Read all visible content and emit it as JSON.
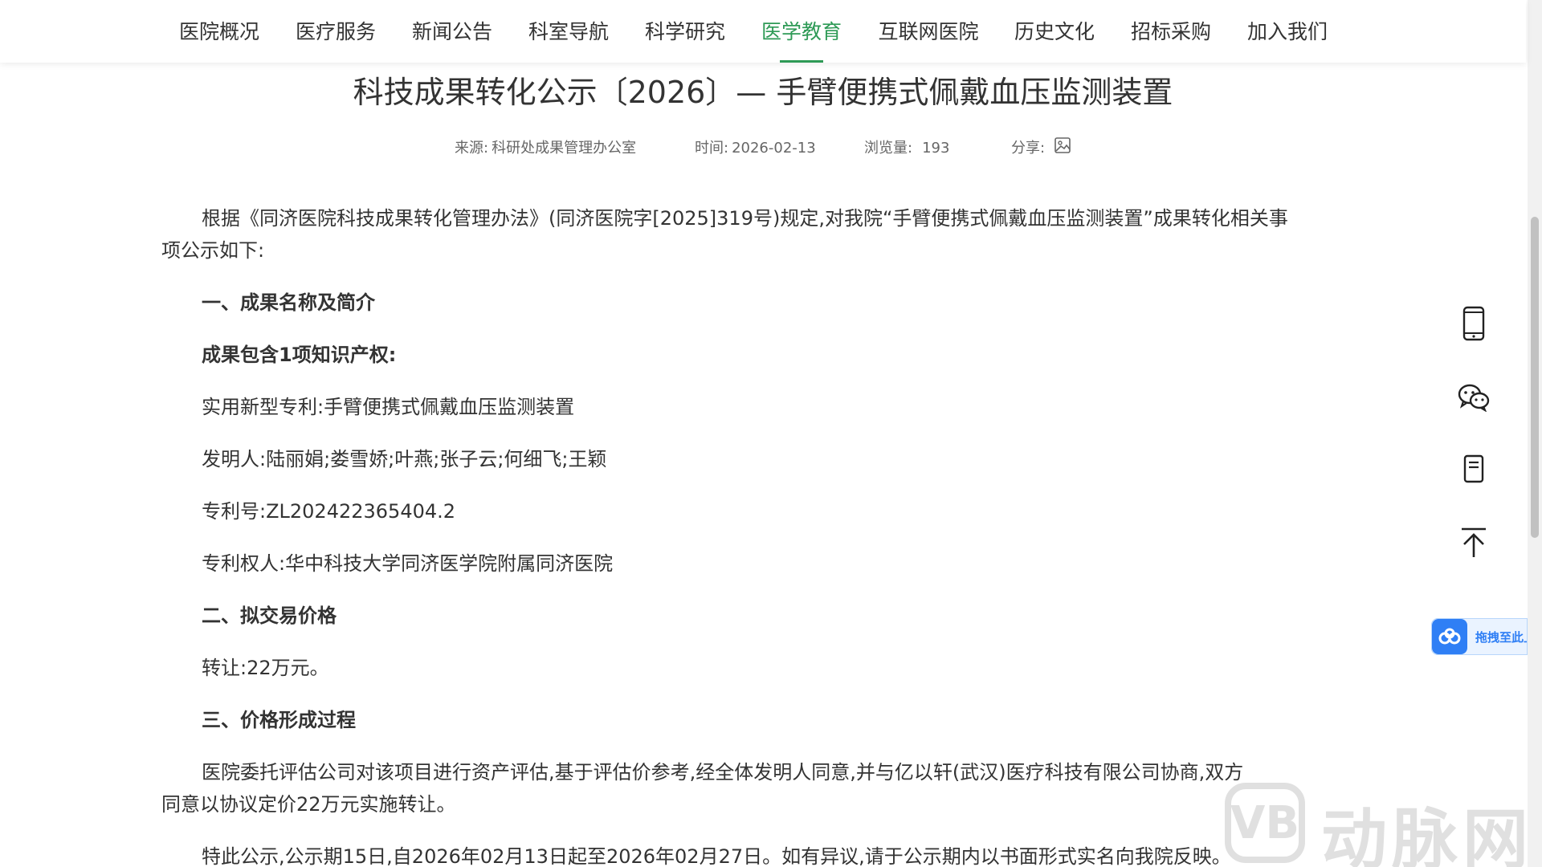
{
  "nav": {
    "items": [
      {
        "label": "医院概况"
      },
      {
        "label": "医疗服务"
      },
      {
        "label": "新闻公告"
      },
      {
        "label": "科室导航"
      },
      {
        "label": "科学研究"
      },
      {
        "label": "医学教育",
        "active": true
      },
      {
        "label": "互联网医院"
      },
      {
        "label": "历史文化"
      },
      {
        "label": "招标采购"
      },
      {
        "label": "加入我们"
      }
    ]
  },
  "article": {
    "title": "科技成果转化公示〔2026〕— 手臂便携式佩戴血压监测装置",
    "meta": {
      "source_label": "来源:",
      "source_value": "科研处成果管理办公室",
      "time_label": "时间:",
      "time_value": "2026-02-13",
      "views_label": "浏览量:",
      "views_value": "193",
      "share_label": "分享:"
    },
    "lines": [
      {
        "text": "根据《同济医院科技成果转化管理办法》(同济医院字[2025]319号)规定,对我院“手臂便携式佩戴血压监测装置”成果转化相关事",
        "bold": false
      },
      {
        "text": "项公示如下:",
        "bold": false
      },
      {
        "text": "一、成果名称及简介",
        "bold": true
      },
      {
        "text": "成果包含1项知识产权:",
        "bold": true
      },
      {
        "text": "实用新型专利:手臂便携式佩戴血压监测装置",
        "bold": false
      },
      {
        "text": "发明人:陆丽娟;娄雪娇;叶燕;张子云;何细飞;王颖",
        "bold": false
      },
      {
        "text": "专利号:ZL202422365404.2",
        "bold": false
      },
      {
        "text": "专利权人:华中科技大学同济医学院附属同济医院",
        "bold": false
      },
      {
        "text": "二、拟交易价格",
        "bold": true
      },
      {
        "text": "转让:22万元。",
        "bold": false
      },
      {
        "text": "三、价格形成过程",
        "bold": true
      },
      {
        "text": "医院委托评估公司对该项目进行资产评估,基于评估价参考,经全体发明人同意,并与亿以轩(武汉)医疗科技有限公司协商,双方",
        "bold": false
      },
      {
        "text": "同意以协议定价22万元实施转让。",
        "bold": false
      },
      {
        "text": "特此公示,公示期15日,自2026年02月13日起至2026年02月27日。如有异议,请于公示期内以书面形式实名向我院反映。",
        "bold": false
      }
    ]
  },
  "side_tools": [
    {
      "icon": "mobile-icon"
    },
    {
      "icon": "wechat-icon"
    },
    {
      "icon": "document-icon"
    },
    {
      "icon": "back-to-top-icon"
    }
  ],
  "upload_widget": {
    "label": "拖拽至此上传",
    "icon": "baidu-netdisk-icon"
  },
  "watermark": {
    "mark": "VB",
    "text": "动脉网"
  },
  "colors": {
    "accent": "#2e9a56",
    "text": "#333333",
    "meta": "#666666",
    "upload": "#2f7ff5"
  }
}
